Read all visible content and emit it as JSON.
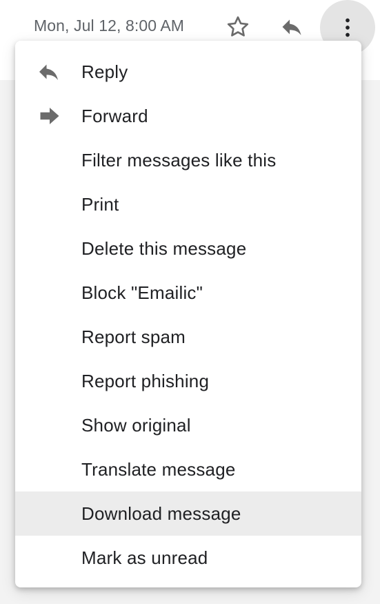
{
  "header": {
    "date": "Mon, Jul 12, 8:00 AM",
    "star_icon": "star-outline-icon",
    "reply_icon": "reply-icon",
    "more_icon": "more-vertical-icon"
  },
  "menu": {
    "items": [
      {
        "label": "Reply",
        "icon": "reply-icon"
      },
      {
        "label": "Forward",
        "icon": "forward-icon"
      },
      {
        "label": "Filter messages like this"
      },
      {
        "label": "Print"
      },
      {
        "label": "Delete this message"
      },
      {
        "label": "Block \"Emailic\""
      },
      {
        "label": "Report spam"
      },
      {
        "label": "Report phishing"
      },
      {
        "label": "Show original"
      },
      {
        "label": "Translate message"
      },
      {
        "label": "Download message",
        "highlighted": true
      },
      {
        "label": "Mark as unread"
      }
    ]
  },
  "colors": {
    "text_primary": "#202124",
    "text_secondary": "#5f6368",
    "icon": "#6b6b6b",
    "highlight": "#ececec",
    "more_button_bg": "#e4e4e4"
  }
}
